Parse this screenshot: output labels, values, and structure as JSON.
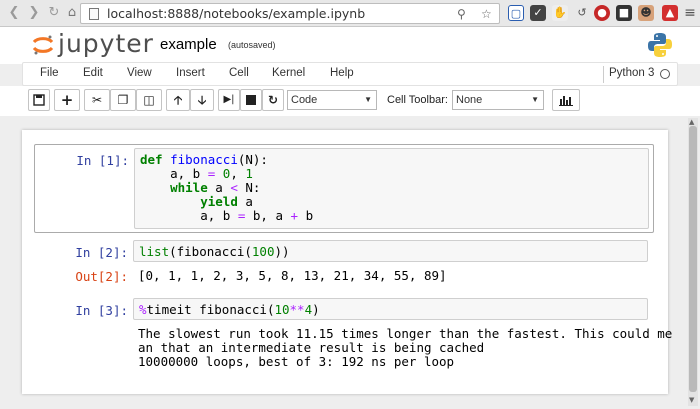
{
  "browser": {
    "url": "localhost:8888/notebooks/example.ipynb"
  },
  "header": {
    "logo_text": "jupyter",
    "notebook_name": "example",
    "save_status": "(autosaved)"
  },
  "menu": {
    "items": [
      "File",
      "Edit",
      "View",
      "Insert",
      "Cell",
      "Kernel",
      "Help"
    ],
    "kernel_name": "Python 3"
  },
  "toolbar": {
    "cell_type": "Code",
    "cell_toolbar_label": "Cell Toolbar:",
    "cell_toolbar_value": "None"
  },
  "cells": [
    {
      "prompt": "In [1]:",
      "code_lines": [
        "def fibonacci(N):",
        "    a, b = 0, 1",
        "    while a < N:",
        "        yield a",
        "        a, b = b, a + b"
      ]
    },
    {
      "prompt": "In [2]:",
      "code": "list(fibonacci(100))",
      "out_prompt": "Out[2]:",
      "output": "[0, 1, 1, 2, 3, 5, 8, 13, 21, 34, 55, 89]"
    },
    {
      "prompt": "In [3]:",
      "code": "%timeit fibonacci(10**4)",
      "output_lines": [
        "The slowest run took 11.15 times longer than the fastest. This could me",
        "an that an intermediate result is being cached",
        "10000000 loops, best of 3: 192 ns per loop"
      ]
    }
  ],
  "colors": {
    "in_prompt": "#303f9f",
    "out_prompt": "#d84315",
    "keyword": "#008000",
    "function_name": "#0000ff",
    "operator": "#aa22ff"
  }
}
